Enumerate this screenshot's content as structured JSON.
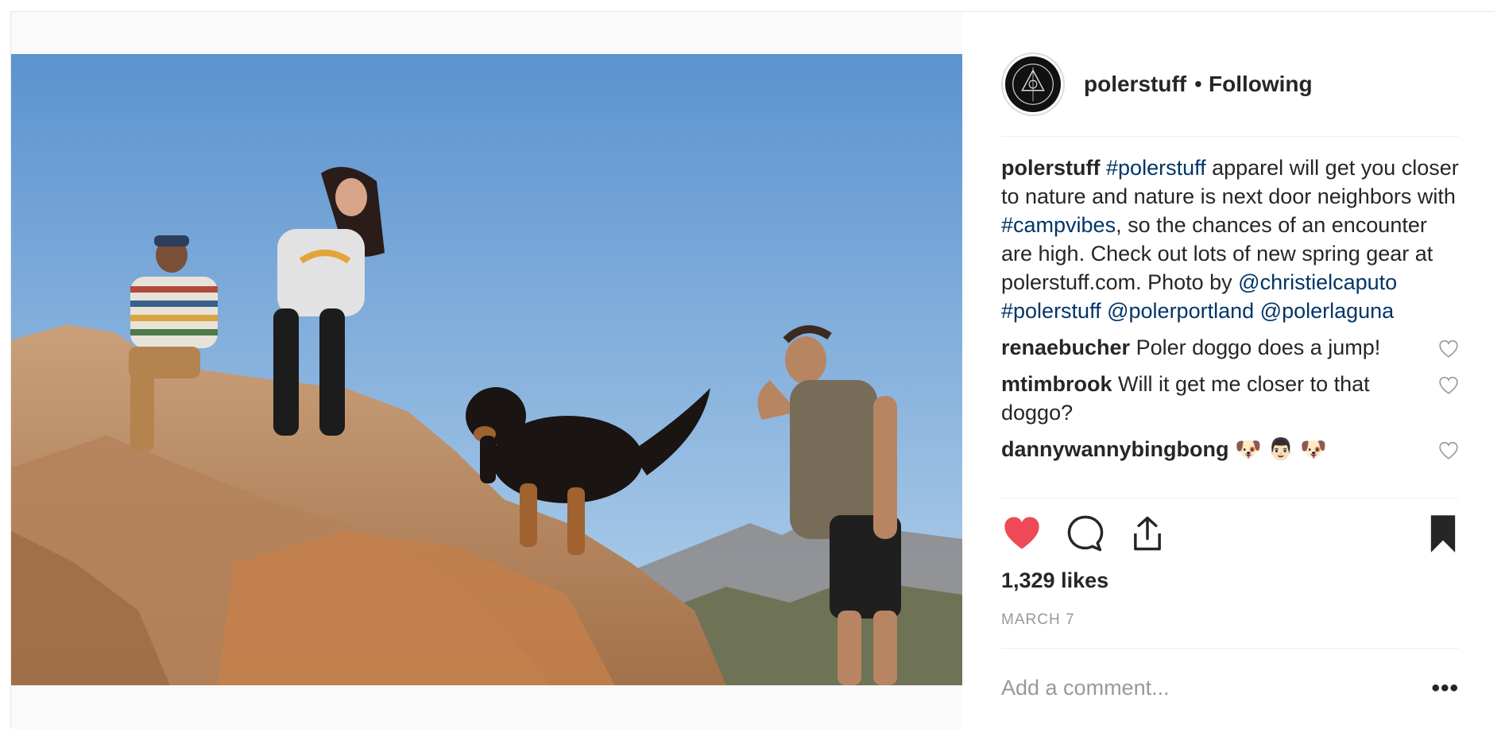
{
  "post": {
    "username": "polerstuff",
    "follow_separator": "•",
    "follow_status": "Following",
    "caption": {
      "username": "polerstuff",
      "parts": [
        {
          "text": "#polerstuff",
          "tag": true
        },
        {
          "text": " apparel will get you closer to nature and nature is next door neighbors with ",
          "tag": false
        },
        {
          "text": "#campvibes",
          "tag": true
        },
        {
          "text": ", so the chances of an encounter are high. Check out lots of new spring gear at polerstuff.com. Photo by ",
          "tag": false
        },
        {
          "text": "@christielcaputo",
          "tag": true
        },
        {
          "text": " ",
          "tag": false
        },
        {
          "text": "#polerstuff",
          "tag": true
        },
        {
          "text": " ",
          "tag": false
        },
        {
          "text": "@polerportland",
          "tag": true
        },
        {
          "text": " ",
          "tag": false
        },
        {
          "text": "@polerlaguna",
          "tag": true
        }
      ]
    },
    "comments": [
      {
        "username": "renaebucher",
        "text": "Poler doggo does a jump!"
      },
      {
        "username": "mtimbrook",
        "text": "Will it get me closer to that doggo?"
      },
      {
        "username": "dannywannybingbong",
        "text": "🐶 👨🏻 🐶"
      }
    ],
    "likes": "1,329 likes",
    "date": "MARCH 7",
    "add_comment_placeholder": "Add a comment...",
    "more_label": "•••",
    "liked": true,
    "saved": true
  },
  "colors": {
    "heart": "#ed4956",
    "tag": "#003569",
    "sky_top": "#5b93cf",
    "sky_bottom": "#b5d2ec",
    "rock": "#b98a5f"
  },
  "icons": {
    "like": "heart-filled-icon",
    "comment": "comment-bubble-icon",
    "share": "share-upload-icon",
    "save": "bookmark-filled-icon",
    "comment_like": "heart-outline-icon"
  }
}
